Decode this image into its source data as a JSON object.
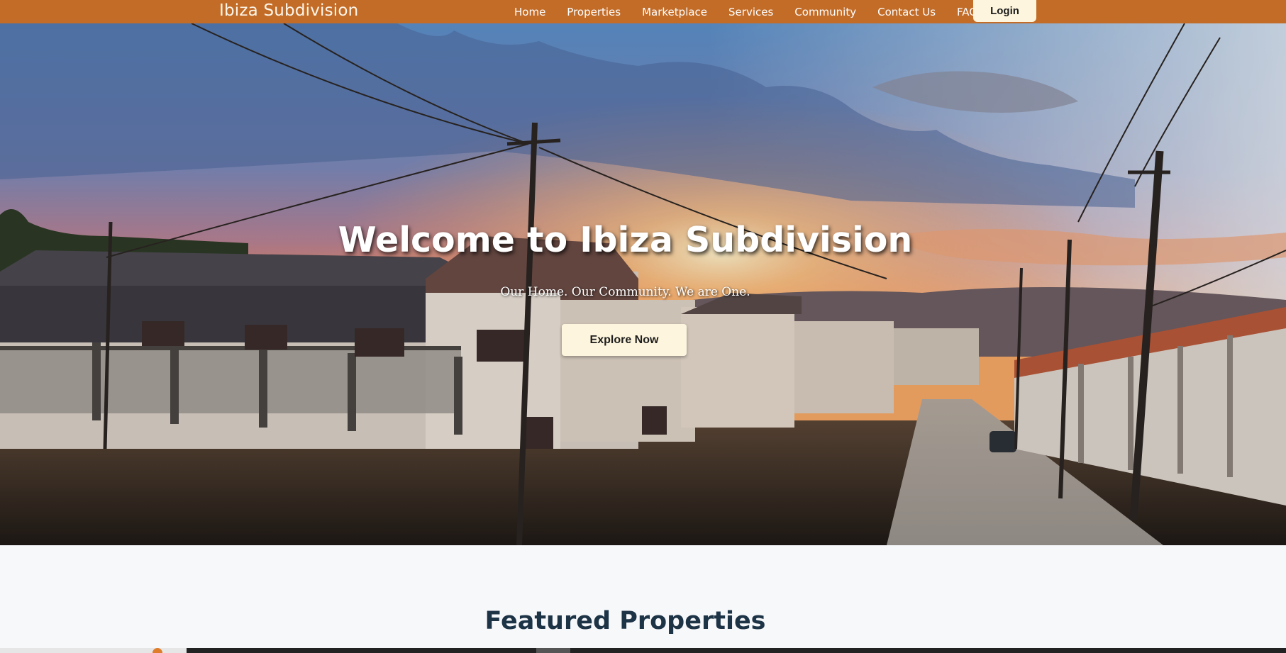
{
  "nav": {
    "brand": "Ibiza Subdivision",
    "items": [
      {
        "label": "Home"
      },
      {
        "label": "Properties"
      },
      {
        "label": "Marketplace"
      },
      {
        "label": "Services"
      },
      {
        "label": "Community"
      },
      {
        "label": "Contact Us"
      },
      {
        "label": "FAQs"
      }
    ],
    "login_label": "Login"
  },
  "hero": {
    "title": "Welcome to Ibiza Subdivision",
    "subtitle": "Our Home. Our Community. We are One.",
    "cta_label": "Explore Now"
  },
  "featured": {
    "heading": "Featured Properties"
  },
  "colors": {
    "navbar": "#c26c28",
    "button_bg": "#fdf5dd",
    "heading": "#1d3346"
  }
}
